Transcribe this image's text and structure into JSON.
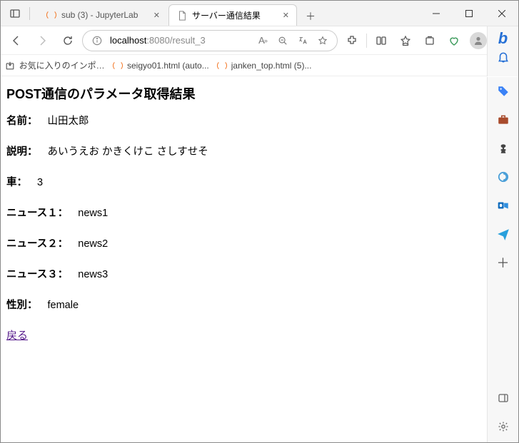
{
  "tabs": [
    {
      "title": "sub (3) - JupyterLab",
      "favicon": "jupyter"
    },
    {
      "title": "サーバー通信結果",
      "favicon": "page"
    }
  ],
  "active_tab_index": 1,
  "address": {
    "host": "localhost",
    "port_path": ":8080/result_3"
  },
  "addressbar_icons": {
    "reader": "A",
    "reader_super": "»"
  },
  "bookmarks": [
    {
      "label": "お気に入りのインポート",
      "icon": "import"
    },
    {
      "label": "seigyo01.html (auto...",
      "icon": "jupyter"
    },
    {
      "label": "janken_top.html (5)...",
      "icon": "jupyter"
    }
  ],
  "page": {
    "heading": "POST通信のパラメータ取得結果",
    "rows": [
      {
        "label": "名前：",
        "value": "山田太郎"
      },
      {
        "label": "説明：",
        "value": "あいうえお かきくけこ さしすせそ"
      },
      {
        "label": "車：",
        "value": "3"
      },
      {
        "label": "ニュース１：",
        "value": "news1"
      },
      {
        "label": "ニュース２：",
        "value": "news2"
      },
      {
        "label": "ニュース３：",
        "value": "news3"
      },
      {
        "label": "性別：",
        "value": "female"
      }
    ],
    "back_link": "戻る"
  },
  "sidebar_icons": {
    "bing": "b",
    "bell": "🔔",
    "tag": "🏷️",
    "briefcase": "💼",
    "chess": "♟",
    "circle": "⭕",
    "outlook": "📧",
    "telegram": "📨",
    "plus": "＋",
    "panel": "▢",
    "gear": "⚙"
  }
}
